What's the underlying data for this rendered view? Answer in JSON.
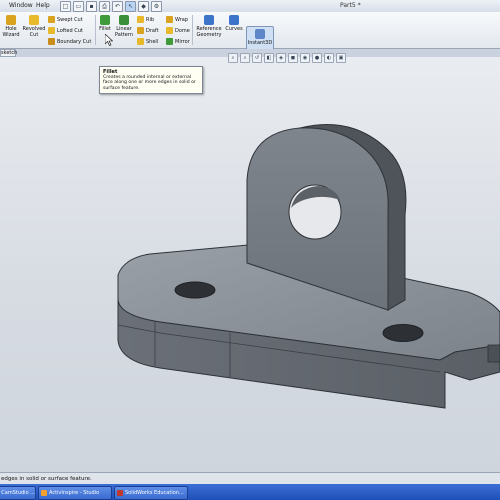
{
  "menu": {
    "items": [
      {
        "label": "Window",
        "id": "window"
      },
      {
        "label": "Help",
        "id": "help"
      }
    ]
  },
  "qat": {
    "icons": [
      "new-icon",
      "open-icon",
      "save-icon",
      "print-icon",
      "undo-icon",
      "select-icon",
      "rebuild-icon",
      "options-icon"
    ]
  },
  "window": {
    "title": "Part5 *"
  },
  "ribbon": {
    "hole_wizard": "Hole\nWizard",
    "revolved_cut": "Revolved\nCut",
    "swept_cut": "Swept Cut",
    "lofted_cut": "Lofted Cut",
    "boundary_cut": "Boundary Cut",
    "fillet": "Fillet",
    "linear_pattern": "Linear\nPattern",
    "rib": "Rib",
    "draft": "Draft",
    "shell": "Shell",
    "wrap": "Wrap",
    "dome": "Dome",
    "mirror": "Mirror",
    "reference_geometry": "Reference\nGeometry",
    "curves": "Curves",
    "instant3d": "Instant3D"
  },
  "tabs": {
    "cutoff_label": "sketch"
  },
  "tooltip": {
    "title": "Fillet",
    "body": "Creates a rounded internal or external face along one or more edges in solid or surface feature."
  },
  "status": {
    "text": "edges in solid or surface feature."
  },
  "taskbar": {
    "items": [
      {
        "label": "CamStudio ...",
        "icon": "camstudio-icon"
      },
      {
        "label": "ActivInspire - Studio",
        "icon": "activinspire-icon"
      },
      {
        "label": "SolidWorks Education...",
        "icon": "solidworks-icon"
      }
    ]
  },
  "colors": {
    "ribbon_icon_yellow": "#e8b92a",
    "ribbon_icon_green": "#3f9a3a",
    "ribbon_icon_blue": "#3c74c9",
    "part_face_light": "#8a9098",
    "part_face_dark": "#5f646b",
    "taskbar": "#2b5cc4"
  }
}
